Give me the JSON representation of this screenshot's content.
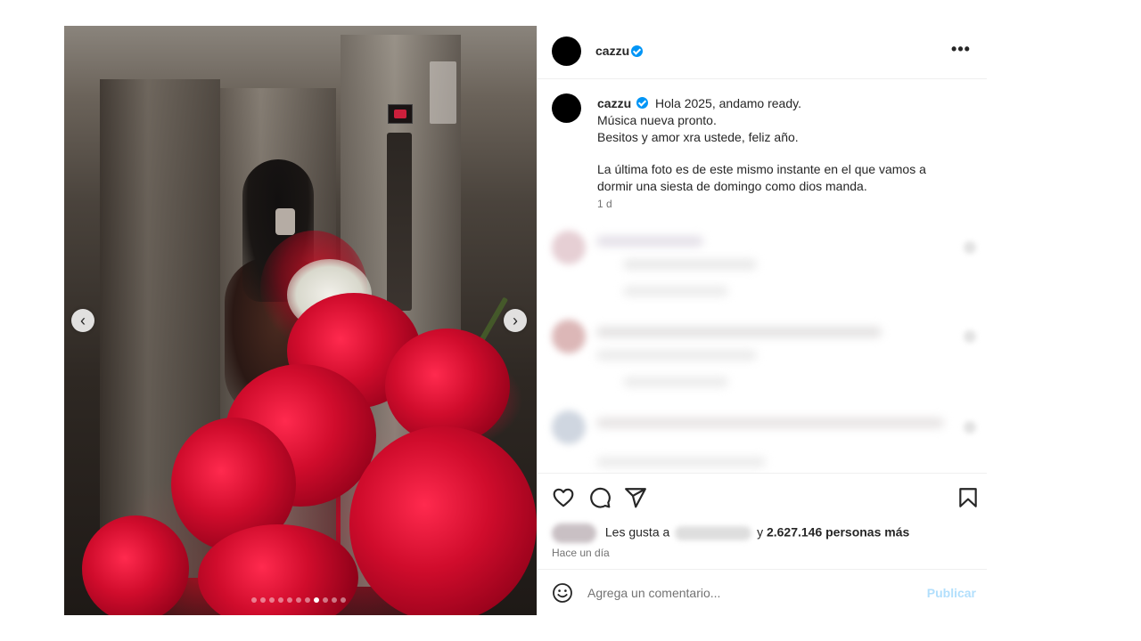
{
  "post": {
    "username": "cazzu",
    "more_label": "•••"
  },
  "caption": {
    "username": "cazzu",
    "lines": [
      "Hola 2025, andamo ready.",
      "Música nueva pronto.",
      "Besitos y amor xra ustede, feliz año.",
      "",
      "La última foto es de este mismo instante en el que vamos a",
      "dormir una siesta de domingo como dios manda."
    ],
    "time": "1 d"
  },
  "carousel": {
    "prev_label": "‹",
    "next_label": "›",
    "total_slides": 11,
    "active_index": 7
  },
  "likes": {
    "prefix": "Les gusta a",
    "connector": "y",
    "count_text": "2.627.146 personas más"
  },
  "time_ago": "Hace un día",
  "comment_box": {
    "placeholder": "Agrega un comentario...",
    "publish_label": "Publicar"
  },
  "icons": [
    "more-icon",
    "heart-icon",
    "comment-icon",
    "share-icon",
    "bookmark-icon",
    "emoji-icon",
    "verified-badge-icon",
    "chevron-left-icon",
    "chevron-right-icon"
  ],
  "colors": {
    "verified": "#0095f6",
    "publish_disabled": "#b2dffc",
    "secondary_text": "#737373"
  }
}
